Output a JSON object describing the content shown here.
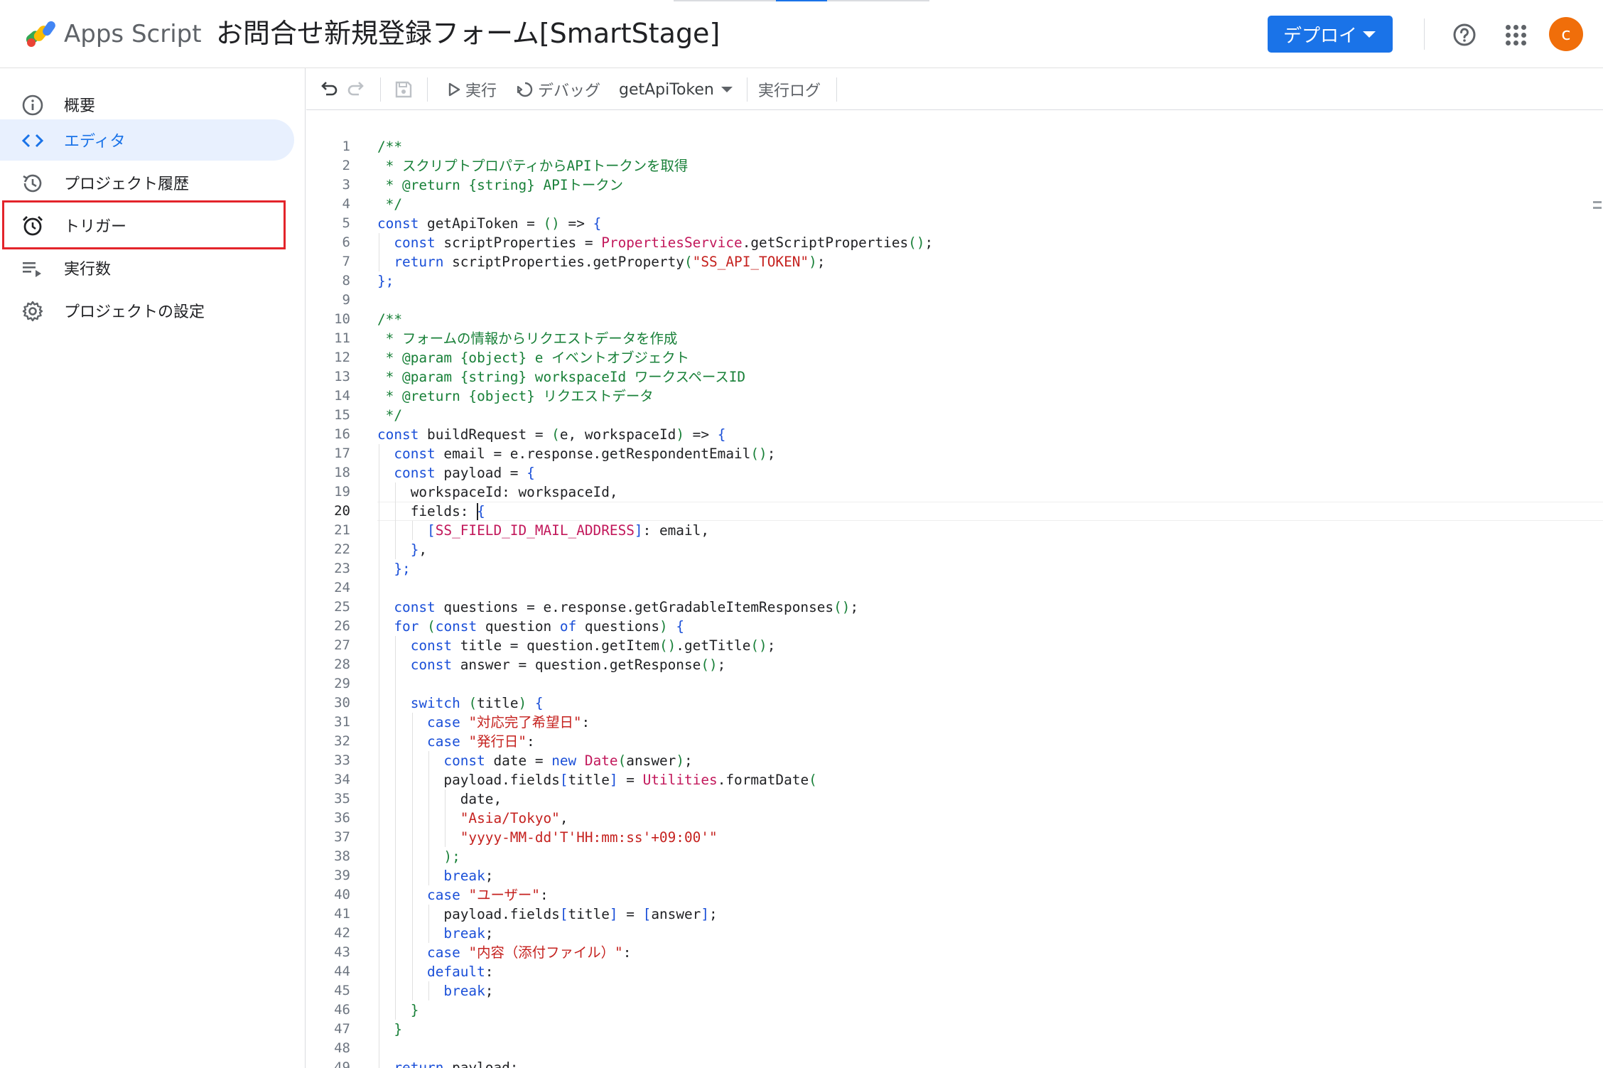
{
  "header": {
    "app_name": "Apps Script",
    "project_title": "お問合せ新規登録フォーム[SmartStage]",
    "deploy_label": "デプロイ",
    "avatar_initial": "c",
    "accent_color": "#1a73e8",
    "avatar_color": "#f06e0a"
  },
  "sidebar": {
    "items": [
      {
        "label": "概要",
        "icon": "info-icon"
      },
      {
        "label": "エディタ",
        "icon": "code-brackets-icon",
        "active": true
      },
      {
        "label": "プロジェクト履歴",
        "icon": "history-icon"
      },
      {
        "label": "トリガー",
        "icon": "alarm-clock-icon",
        "highlighted": true
      },
      {
        "label": "実行数",
        "icon": "executions-list-icon"
      },
      {
        "label": "プロジェクトの設定",
        "icon": "gear-icon"
      }
    ],
    "highlight_color": "#e3242b"
  },
  "toolbar": {
    "run_label": "実行",
    "debug_label": "デバッグ",
    "function_name": "getApiToken",
    "log_label": "実行ログ"
  },
  "editor": {
    "current_line": 20,
    "lines": [
      "1",
      "2",
      "3",
      "4",
      "5",
      "6",
      "7",
      "8",
      "9",
      "10",
      "11",
      "12",
      "13",
      "14",
      "15",
      "16",
      "17",
      "18",
      "19",
      "20",
      "21",
      "22",
      "23",
      "24",
      "25",
      "26",
      "27",
      "28",
      "29",
      "30",
      "31",
      "32",
      "33",
      "34",
      "35",
      "36",
      "37",
      "38",
      "39",
      "40",
      "41",
      "42",
      "43",
      "44",
      "45",
      "46",
      "47",
      "48",
      "49"
    ],
    "code": [
      [
        [
          "/**",
          "comment"
        ]
      ],
      [
        [
          " * スクリプトプロパティからAPIトークンを取得",
          "comment"
        ]
      ],
      [
        [
          " * @return {string} APIトークン",
          "comment"
        ]
      ],
      [
        [
          " */",
          "comment"
        ]
      ],
      [
        [
          "const",
          "kw"
        ],
        [
          " getApiToken = ",
          ""
        ],
        [
          "()",
          "paren"
        ],
        [
          " => ",
          ""
        ],
        [
          "{",
          "punc"
        ]
      ],
      [
        [
          "  ",
          ""
        ],
        [
          "const",
          "kw"
        ],
        [
          " scriptProperties = ",
          ""
        ],
        [
          "PropertiesService",
          "cls"
        ],
        [
          ".getScriptProperties",
          ""
        ],
        [
          "()",
          "paren"
        ],
        [
          ";",
          ""
        ]
      ],
      [
        [
          "  ",
          ""
        ],
        [
          "return",
          "kw"
        ],
        [
          " scriptProperties.getProperty",
          ""
        ],
        [
          "(",
          "paren"
        ],
        [
          "\"SS_API_TOKEN\"",
          "str"
        ],
        [
          ")",
          "paren"
        ],
        [
          ";",
          ""
        ]
      ],
      [
        [
          "};",
          "punc"
        ]
      ],
      [],
      [
        [
          "/**",
          "comment"
        ]
      ],
      [
        [
          " * フォームの情報からリクエストデータを作成",
          "comment"
        ]
      ],
      [
        [
          " * @param {object} e イベントオブジェクト",
          "comment"
        ]
      ],
      [
        [
          " * @param {string} workspaceId ワークスペースID",
          "comment"
        ]
      ],
      [
        [
          " * @return {object} リクエストデータ",
          "comment"
        ]
      ],
      [
        [
          " */",
          "comment"
        ]
      ],
      [
        [
          "const",
          "kw"
        ],
        [
          " buildRequest = ",
          ""
        ],
        [
          "(",
          "paren"
        ],
        [
          "e, workspaceId",
          ""
        ],
        [
          ")",
          "paren"
        ],
        [
          " => ",
          ""
        ],
        [
          "{",
          "punc"
        ]
      ],
      [
        [
          "  ",
          ""
        ],
        [
          "const",
          "kw"
        ],
        [
          " email = e.response.getRespondentEmail",
          ""
        ],
        [
          "()",
          "paren"
        ],
        [
          ";",
          ""
        ]
      ],
      [
        [
          "  ",
          ""
        ],
        [
          "const",
          "kw"
        ],
        [
          " payload = ",
          ""
        ],
        [
          "{",
          "punc"
        ]
      ],
      [
        [
          "    workspaceId: workspaceId,",
          ""
        ]
      ],
      [
        [
          "    fields: ",
          ""
        ],
        [
          "{",
          "punc"
        ]
      ],
      [
        [
          "      ",
          ""
        ],
        [
          "[",
          "punc"
        ],
        [
          "SS_FIELD_ID_MAIL_ADDRESS",
          "const"
        ],
        [
          "]",
          "punc"
        ],
        [
          ": email,",
          ""
        ]
      ],
      [
        [
          "    ",
          ""
        ],
        [
          "}",
          "punc"
        ],
        [
          ",",
          ""
        ]
      ],
      [
        [
          "  ",
          ""
        ],
        [
          "};",
          "punc"
        ]
      ],
      [],
      [
        [
          "  ",
          ""
        ],
        [
          "const",
          "kw"
        ],
        [
          " questions = e.response.getGradableItemResponses",
          ""
        ],
        [
          "()",
          "paren"
        ],
        [
          ";",
          ""
        ]
      ],
      [
        [
          "  ",
          ""
        ],
        [
          "for",
          "kw"
        ],
        [
          " ",
          ""
        ],
        [
          "(",
          "paren"
        ],
        [
          "const",
          "kw"
        ],
        [
          " question ",
          ""
        ],
        [
          "of",
          "kw"
        ],
        [
          " questions",
          ""
        ],
        [
          ")",
          "paren"
        ],
        [
          " ",
          ""
        ],
        [
          "{",
          "punc"
        ]
      ],
      [
        [
          "    ",
          ""
        ],
        [
          "const",
          "kw"
        ],
        [
          " title = question.getItem",
          ""
        ],
        [
          "()",
          "paren"
        ],
        [
          ".getTitle",
          ""
        ],
        [
          "()",
          "paren"
        ],
        [
          ";",
          ""
        ]
      ],
      [
        [
          "    ",
          ""
        ],
        [
          "const",
          "kw"
        ],
        [
          " answer = question.getResponse",
          ""
        ],
        [
          "()",
          "paren"
        ],
        [
          ";",
          ""
        ]
      ],
      [],
      [
        [
          "    ",
          ""
        ],
        [
          "switch",
          "kw"
        ],
        [
          " ",
          ""
        ],
        [
          "(",
          "paren"
        ],
        [
          "title",
          ""
        ],
        [
          ")",
          "paren"
        ],
        [
          " ",
          ""
        ],
        [
          "{",
          "punc"
        ]
      ],
      [
        [
          "      ",
          ""
        ],
        [
          "case",
          "kw"
        ],
        [
          " ",
          ""
        ],
        [
          "\"対応完了希望日\"",
          "str"
        ],
        [
          ":",
          ""
        ]
      ],
      [
        [
          "      ",
          ""
        ],
        [
          "case",
          "kw"
        ],
        [
          " ",
          ""
        ],
        [
          "\"発行日\"",
          "str"
        ],
        [
          ":",
          ""
        ]
      ],
      [
        [
          "        ",
          ""
        ],
        [
          "const",
          "kw"
        ],
        [
          " date = ",
          ""
        ],
        [
          "new",
          "kw"
        ],
        [
          " ",
          ""
        ],
        [
          "Date",
          "cls"
        ],
        [
          "(",
          "paren"
        ],
        [
          "answer",
          ""
        ],
        [
          ")",
          "paren"
        ],
        [
          ";",
          ""
        ]
      ],
      [
        [
          "        payload.fields",
          ""
        ],
        [
          "[",
          "punc"
        ],
        [
          "title",
          ""
        ],
        [
          "]",
          "punc"
        ],
        [
          " = ",
          ""
        ],
        [
          "Utilities",
          "cls"
        ],
        [
          ".formatDate",
          ""
        ],
        [
          "(",
          "paren"
        ]
      ],
      [
        [
          "          date,",
          ""
        ]
      ],
      [
        [
          "          ",
          ""
        ],
        [
          "\"Asia/Tokyo\"",
          "str"
        ],
        [
          ",",
          ""
        ]
      ],
      [
        [
          "          ",
          ""
        ],
        [
          "\"yyyy-MM-dd'T'HH:mm:ss'+09:00'\"",
          "str"
        ]
      ],
      [
        [
          "        ",
          ""
        ],
        [
          ");",
          "paren"
        ]
      ],
      [
        [
          "        ",
          ""
        ],
        [
          "break",
          "kw"
        ],
        [
          ";",
          ""
        ]
      ],
      [
        [
          "      ",
          ""
        ],
        [
          "case",
          "kw"
        ],
        [
          " ",
          ""
        ],
        [
          "\"ユーザー\"",
          "str"
        ],
        [
          ":",
          ""
        ]
      ],
      [
        [
          "        payload.fields",
          ""
        ],
        [
          "[",
          "punc"
        ],
        [
          "title",
          ""
        ],
        [
          "]",
          "punc"
        ],
        [
          " = ",
          ""
        ],
        [
          "[",
          "punc"
        ],
        [
          "answer",
          ""
        ],
        [
          "]",
          "punc"
        ],
        [
          ";",
          ""
        ]
      ],
      [
        [
          "        ",
          ""
        ],
        [
          "break",
          "kw"
        ],
        [
          ";",
          ""
        ]
      ],
      [
        [
          "      ",
          ""
        ],
        [
          "case",
          "kw"
        ],
        [
          " ",
          ""
        ],
        [
          "\"内容（添付ファイル）\"",
          "str"
        ],
        [
          ":",
          ""
        ]
      ],
      [
        [
          "      ",
          ""
        ],
        [
          "default",
          "kw"
        ],
        [
          ":",
          ""
        ]
      ],
      [
        [
          "        ",
          ""
        ],
        [
          "break",
          "kw"
        ],
        [
          ";",
          ""
        ]
      ],
      [
        [
          "    ",
          ""
        ],
        [
          "}",
          "paren"
        ]
      ],
      [
        [
          "  ",
          ""
        ],
        [
          "}",
          "paren"
        ]
      ],
      [],
      [
        [
          "  ",
          ""
        ],
        [
          "return",
          "kw"
        ],
        [
          " payload;",
          ""
        ]
      ]
    ]
  }
}
